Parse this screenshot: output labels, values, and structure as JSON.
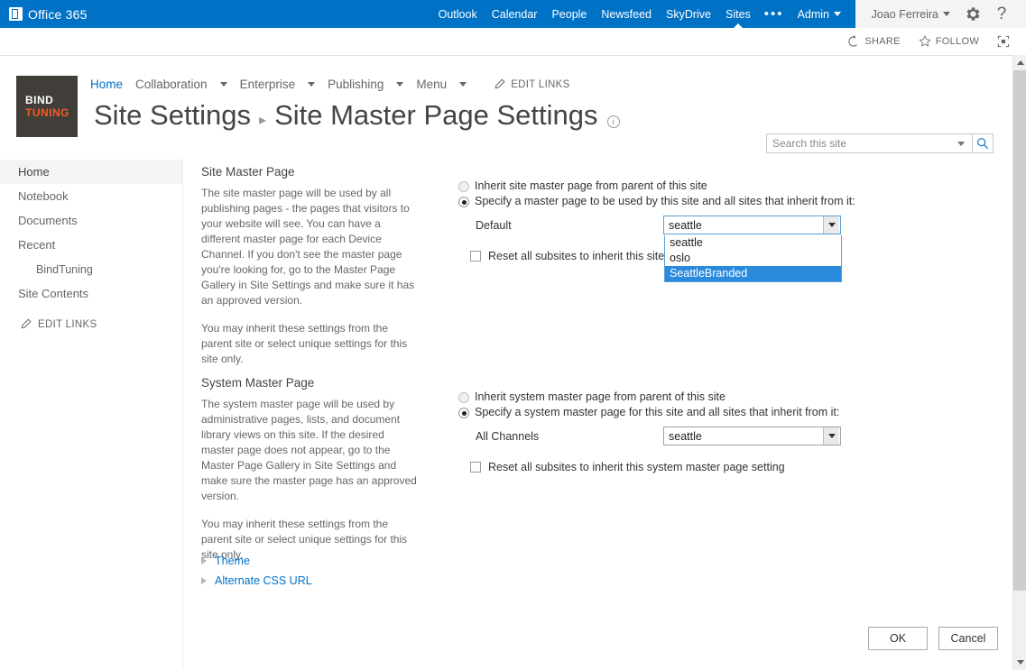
{
  "suite_bar": {
    "brand": "Office 365",
    "nav": [
      {
        "label": "Outlook",
        "active": false
      },
      {
        "label": "Calendar",
        "active": false
      },
      {
        "label": "People",
        "active": false
      },
      {
        "label": "Newsfeed",
        "active": false
      },
      {
        "label": "SkyDrive",
        "active": false
      },
      {
        "label": "Sites",
        "active": true
      }
    ],
    "overflow": "•••",
    "admin_label": "Admin",
    "user_name": "Joao Ferreira",
    "settings_icon": "gear-icon",
    "help_icon": "help-icon",
    "accent_color": "#0072c6"
  },
  "share_row": {
    "share_label": "SHARE",
    "follow_label": "FOLLOW",
    "focus_label": "",
    "share_icon": "share-icon",
    "follow_icon": "star-icon",
    "focus_icon": "focus-on-content-icon"
  },
  "header": {
    "logo": {
      "line1": "BIND",
      "line2": "TUNING",
      "bg": "#413e39",
      "accent": "#f15a22"
    },
    "nav": [
      {
        "label": "Home",
        "selected": true,
        "has_caret": false
      },
      {
        "label": "Collaboration",
        "selected": false,
        "has_caret": true
      },
      {
        "label": "Enterprise",
        "selected": false,
        "has_caret": true
      },
      {
        "label": "Publishing",
        "selected": false,
        "has_caret": true
      },
      {
        "label": "Menu",
        "selected": false,
        "has_caret": true
      }
    ],
    "edit_links": "EDIT LINKS",
    "title_parent": "Site Settings",
    "title_separator": "▸",
    "title_current": "Site Master Page Settings",
    "info_glyph": "i"
  },
  "search": {
    "value": "",
    "placeholder": "Search this site",
    "dropdown_icon": "chevron-down-icon",
    "search_icon": "search-icon"
  },
  "left_nav": {
    "items": [
      {
        "label": "Home",
        "selected": true,
        "sub": false
      },
      {
        "label": "Notebook",
        "selected": false,
        "sub": false
      },
      {
        "label": "Documents",
        "selected": false,
        "sub": false
      },
      {
        "label": "Recent",
        "selected": false,
        "sub": false
      },
      {
        "label": "BindTuning",
        "selected": false,
        "sub": true
      },
      {
        "label": "Site Contents",
        "selected": false,
        "sub": false
      }
    ],
    "edit_links": "EDIT LINKS"
  },
  "site_master_page": {
    "title": "Site Master Page",
    "desc1": "The site master page will be used by all publishing pages - the pages that visitors to your website will see. You can have a different master page for each Device Channel. If you don't see the master page you're looking for, go to the Master Page Gallery in Site Settings and make sure it has an approved version.",
    "desc2": "You may inherit these settings from the parent site or select unique settings for this site only.",
    "option_inherit": "Inherit site master page from parent of this site",
    "option_specify": "Specify a master page to be used by this site and all sites that inherit from it:",
    "selected_option": "specify",
    "field_label": "Default",
    "selected_value": "seattle",
    "dropdown_open": true,
    "options": [
      {
        "label": "seattle",
        "highlighted": false
      },
      {
        "label": "oslo",
        "highlighted": false
      },
      {
        "label": "SeattleBranded",
        "highlighted": true
      }
    ],
    "reset_label": "Reset all subsites to inherit this site master page setting",
    "reset_checked": false,
    "highlight_color": "#2a8ade"
  },
  "system_master_page": {
    "title": "System Master Page",
    "desc1": "The system master page will be used by administrative pages, lists, and document library views on this site. If the desired master page does not appear, go to the Master Page Gallery in Site Settings and make sure the master page has an approved version.",
    "desc2": "You may inherit these settings from the parent site or select unique settings for this site only.",
    "option_inherit": "Inherit system master page from parent of this site",
    "option_specify": "Specify a system master page for this site and all sites that inherit from it:",
    "selected_option": "specify",
    "field_label": "All Channels",
    "selected_value": "seattle",
    "reset_label": "Reset all subsites to inherit this system master page setting",
    "reset_checked": false
  },
  "expandables": [
    {
      "label": "Theme"
    },
    {
      "label": "Alternate CSS URL"
    }
  ],
  "actions": {
    "ok": "OK",
    "cancel": "Cancel"
  }
}
